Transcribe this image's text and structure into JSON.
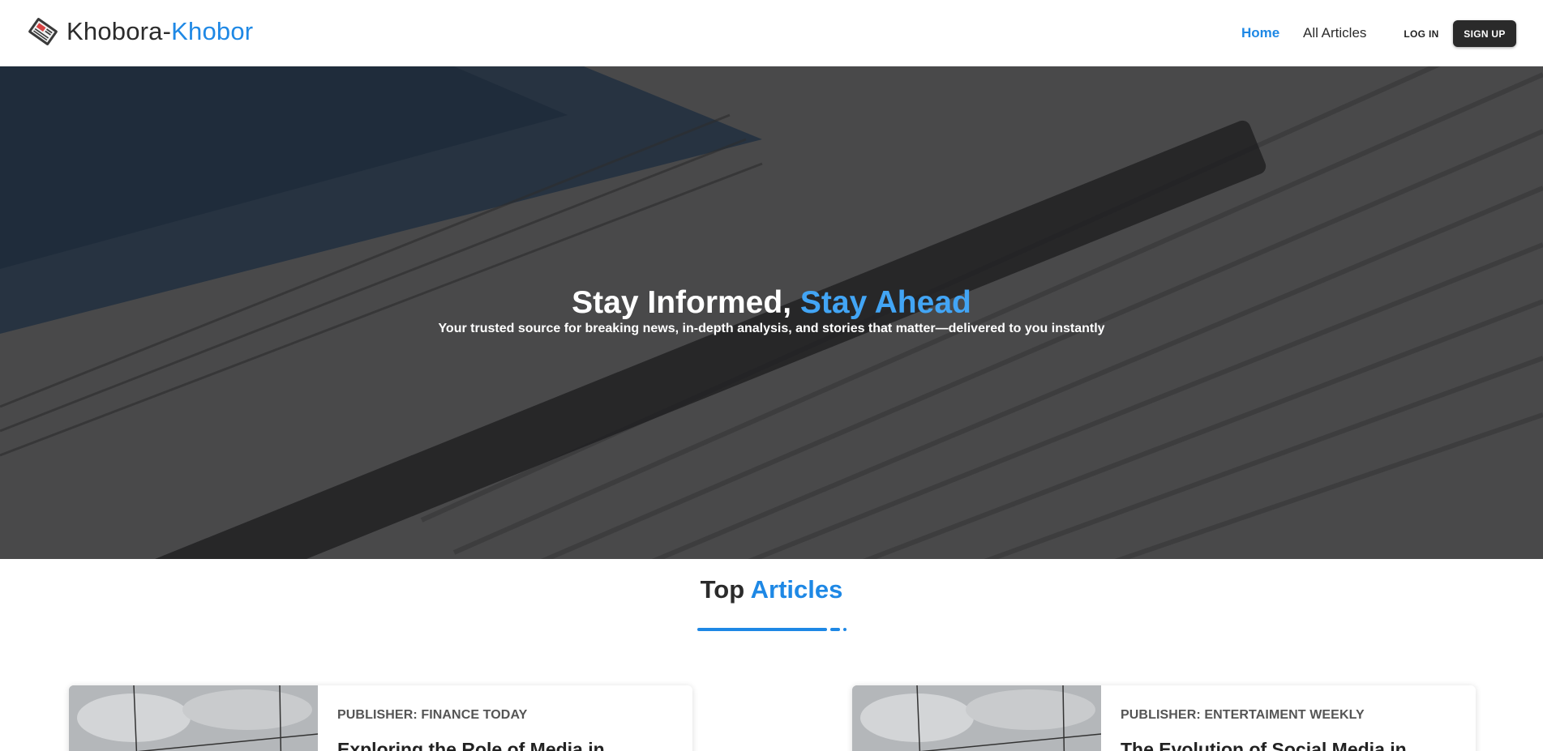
{
  "brand": {
    "name_main": "Khobora-",
    "name_accent": "Khobor",
    "icon": "newspaper-icon"
  },
  "nav": {
    "home": "Home",
    "all_articles": "All Articles",
    "login": "LOG IN",
    "signup": "SIGN UP"
  },
  "hero": {
    "title_main": "Stay Informed,",
    "title_accent": "Stay Ahead",
    "subtitle": "Your trusted source for breaking news, in-depth analysis, and stories that matter—delivered to you instantly",
    "background": "newspaper-photo"
  },
  "section": {
    "title_main": "Top",
    "title_accent": "Articles"
  },
  "articles": [
    {
      "publisher": "PUBLISHER: FINANCE TODAY",
      "title": "Exploring the Role of Media in"
    },
    {
      "publisher": "PUBLISHER: ENTERTAIMENT WEEKLY",
      "title": "The Evolution of Social Media in"
    }
  ],
  "colors": {
    "accent": "#1e88e5",
    "dark": "#2a2a2a"
  }
}
